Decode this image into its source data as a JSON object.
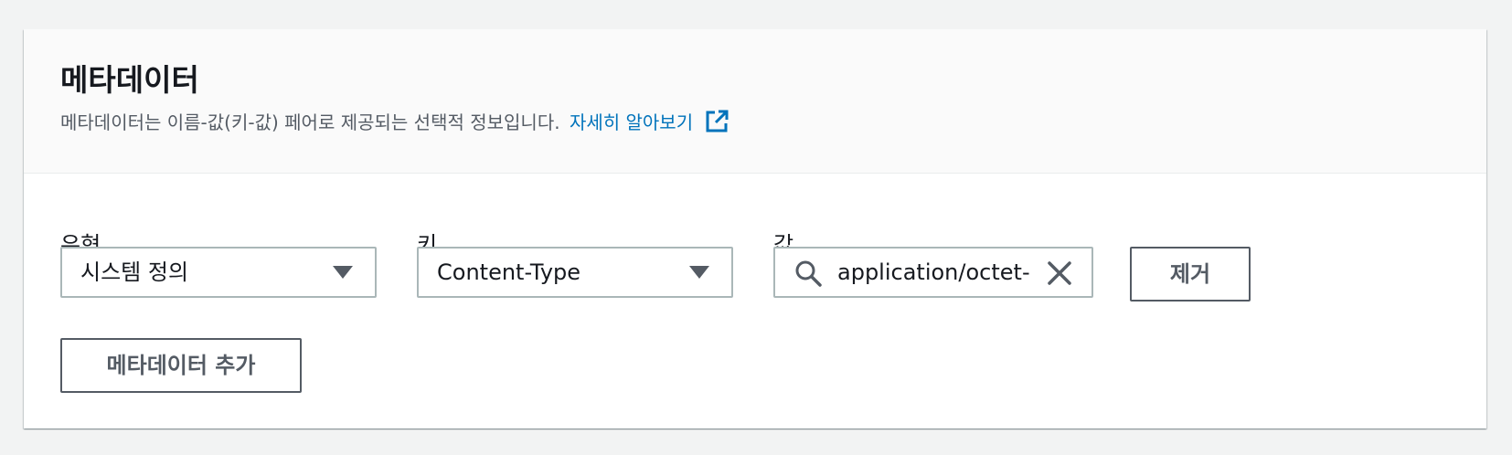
{
  "panel": {
    "title": "메타데이터",
    "description": "메타데이터는 이름-값(키-값) 페어로 제공되는 선택적 정보입니다.",
    "learn_more_label": "자세히 알아보기",
    "external_link_icon": "external-link-icon"
  },
  "fields": {
    "type_label": "유형",
    "key_label": "키",
    "value_label": "값"
  },
  "row": {
    "type_value": "시스템 정의",
    "key_value": "Content-Type",
    "value_value": "application/octet-stream",
    "search_icon": "search-icon",
    "clear_icon": "clear-icon",
    "remove_label": "제거"
  },
  "actions": {
    "add_metadata_label": "메타데이터 추가"
  },
  "colors": {
    "link": "#0073bb",
    "border": "#aab7b8",
    "button_border": "#545b64",
    "header_bg": "#fafafa"
  }
}
